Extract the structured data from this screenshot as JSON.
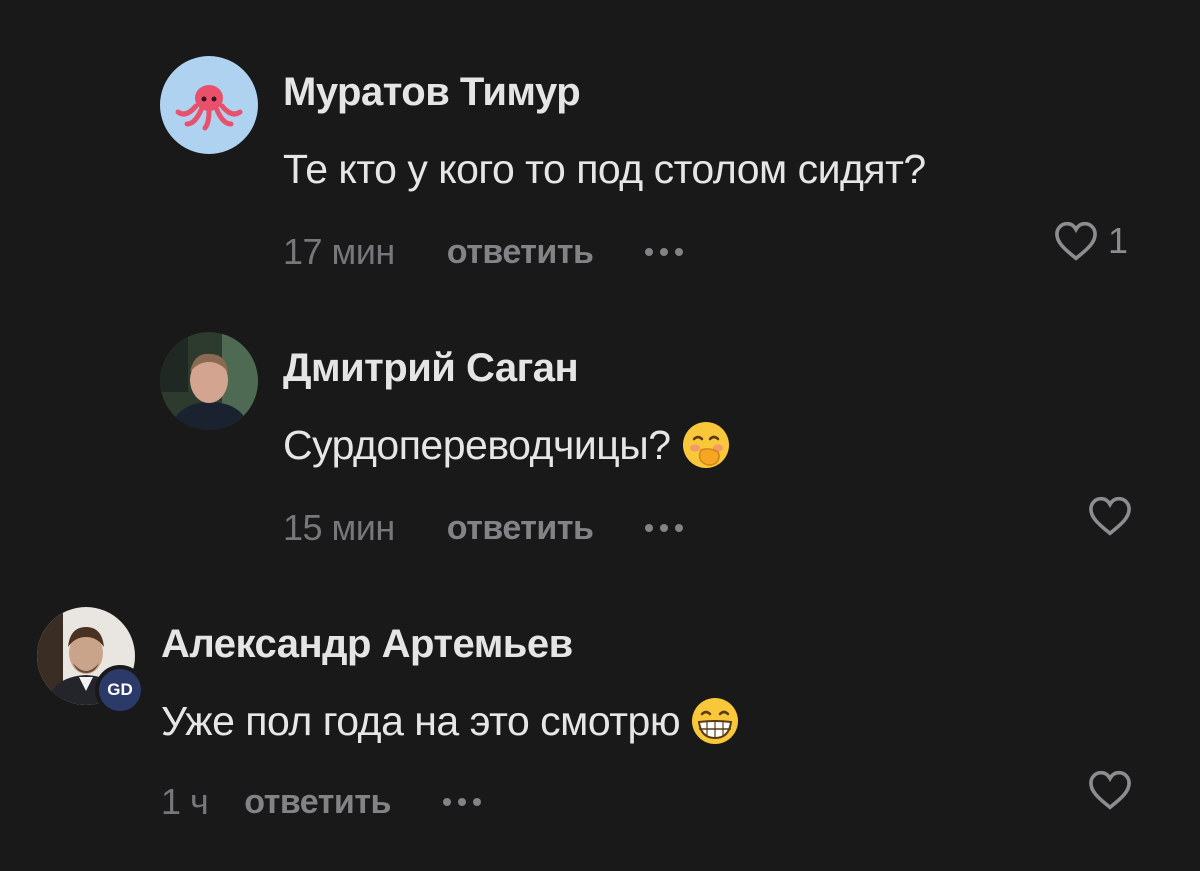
{
  "comments": [
    {
      "author": "Муратов Тимур",
      "text": "Те кто у кого то под столом сидят?",
      "time": "17 мин",
      "reply_label": "ответить",
      "likes": "1",
      "avatar_icon": "octopus-icon",
      "emoji_icon": ""
    },
    {
      "author": "Дмитрий Саган",
      "text": "Сурдопереводчицы?",
      "time": "15 мин",
      "reply_label": "ответить",
      "likes": "",
      "avatar_icon": "user-photo",
      "emoji_icon": "face-with-hand-over-mouth-emoji"
    },
    {
      "author": "Александр Артемьев",
      "text": "Уже пол года на это смотрю",
      "time": "1 ч",
      "reply_label": "ответить",
      "likes": "",
      "avatar_icon": "user-photo",
      "badge": "GD",
      "emoji_icon": "grinning-face-emoji"
    }
  ],
  "colors": {
    "background": "#19191a",
    "text": "#e6e6e7",
    "muted": "#77777a",
    "badge": "#2b3a68"
  }
}
